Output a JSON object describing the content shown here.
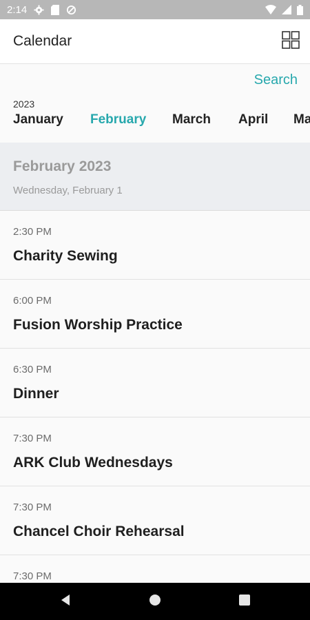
{
  "status_bar": {
    "time": "2:14",
    "icons": [
      "settings-icon",
      "sd-card-icon",
      "sync-icon",
      "wifi-icon",
      "signal-icon",
      "battery-icon"
    ]
  },
  "app_bar": {
    "title": "Calendar",
    "grid_icon": "grid-view-icon"
  },
  "header": {
    "search_label": "Search",
    "year": "2023",
    "months": [
      {
        "label": "January",
        "active": false
      },
      {
        "label": "February",
        "active": true
      },
      {
        "label": "March",
        "active": false
      },
      {
        "label": "April",
        "active": false
      },
      {
        "label": "Ma",
        "active": false
      }
    ],
    "accent_color": "#27a8ad"
  },
  "section": {
    "month_title": "February 2023",
    "date_label": "Wednesday, February 1"
  },
  "events": [
    {
      "time": "2:30 PM",
      "title": "Charity Sewing"
    },
    {
      "time": "6:00 PM",
      "title": "Fusion Worship Practice"
    },
    {
      "time": "6:30 PM",
      "title": "Dinner"
    },
    {
      "time": "7:30 PM",
      "title": "ARK Club Wednesdays"
    },
    {
      "time": "7:30 PM",
      "title": "Chancel Choir Rehearsal"
    },
    {
      "time": "7:30 PM",
      "title": ""
    }
  ],
  "nav_bar": {
    "icons": [
      "back-icon",
      "home-icon",
      "recents-icon"
    ]
  }
}
